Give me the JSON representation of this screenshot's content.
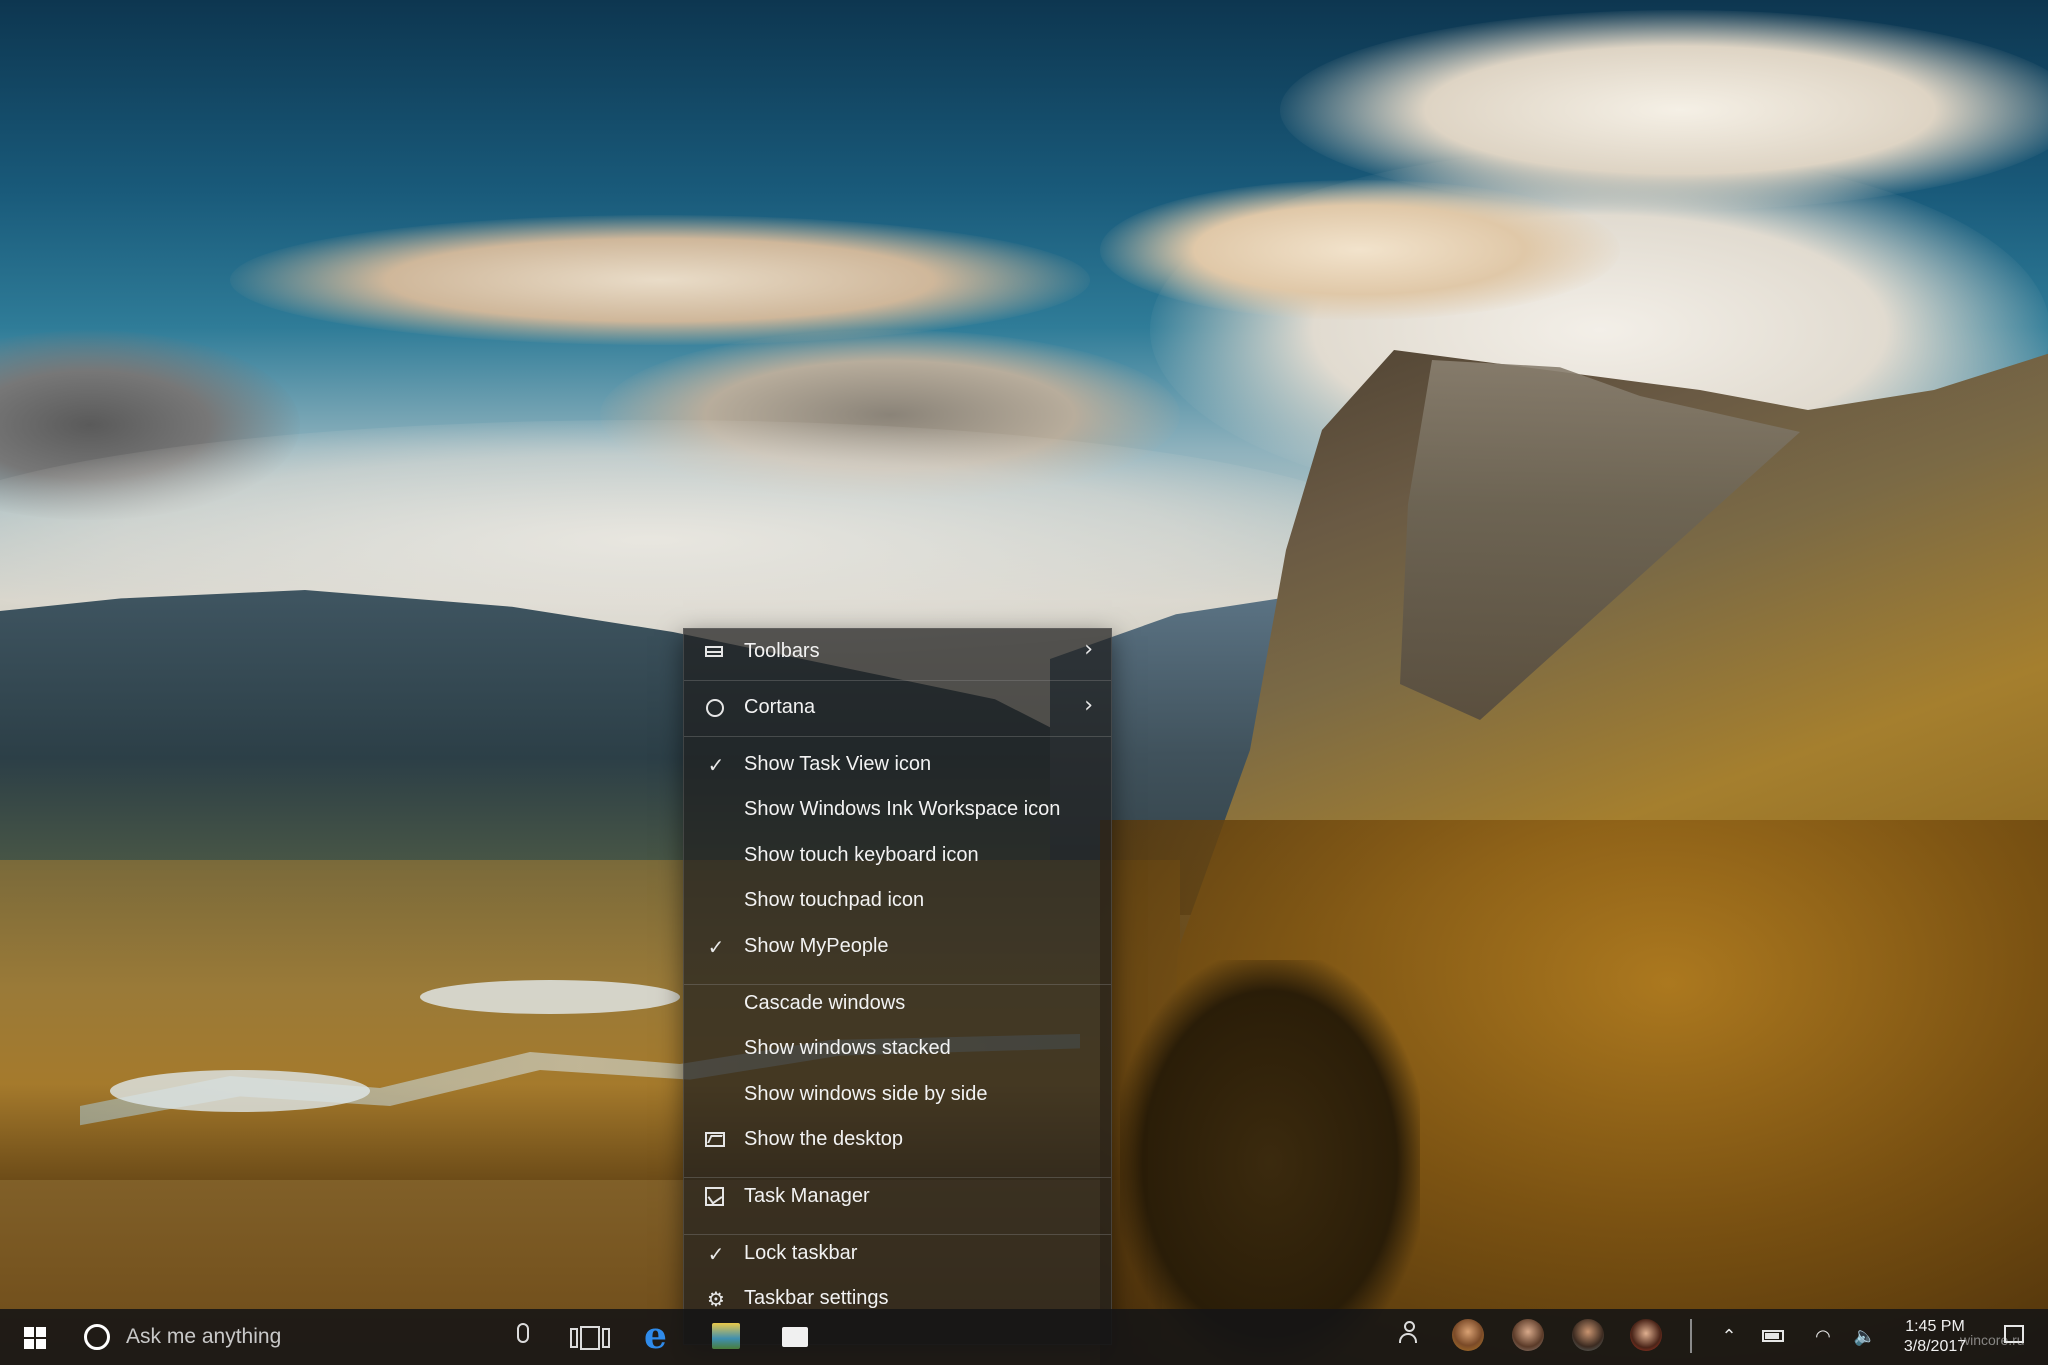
{
  "context_menu": {
    "items": [
      {
        "label": "Toolbars",
        "icon": "toolbars-icon",
        "submenu": true,
        "checked": false
      },
      {
        "label": "Cortana",
        "icon": "cortana-icon",
        "submenu": true,
        "checked": false
      },
      {
        "label": "Show Task View icon",
        "checked": true
      },
      {
        "label": "Show Windows Ink Workspace icon",
        "checked": false
      },
      {
        "label": "Show touch keyboard icon",
        "checked": false
      },
      {
        "label": "Show touchpad icon",
        "checked": false
      },
      {
        "label": "Show MyPeople",
        "checked": true
      },
      {
        "label": "Cascade windows",
        "checked": false
      },
      {
        "label": "Show windows stacked",
        "checked": false
      },
      {
        "label": "Show windows side by side",
        "checked": false
      },
      {
        "label": "Show the desktop",
        "icon": "show-desktop-icon",
        "checked": false
      },
      {
        "label": "Task Manager",
        "icon": "task-manager-icon",
        "checked": false
      },
      {
        "label": "Lock taskbar",
        "checked": true
      },
      {
        "label": "Taskbar settings",
        "icon": "gear-icon",
        "checked": false
      }
    ]
  },
  "taskbar": {
    "search_placeholder": "Ask me anything",
    "clock_time": "1:45 PM",
    "clock_date": "3/8/2017",
    "pinned_apps": [
      "edge-icon",
      "photos-app-icon",
      "file-app-icon"
    ],
    "people_contacts": 4,
    "accent_color": "#2f8bea"
  },
  "watermark": "wincore.ru"
}
